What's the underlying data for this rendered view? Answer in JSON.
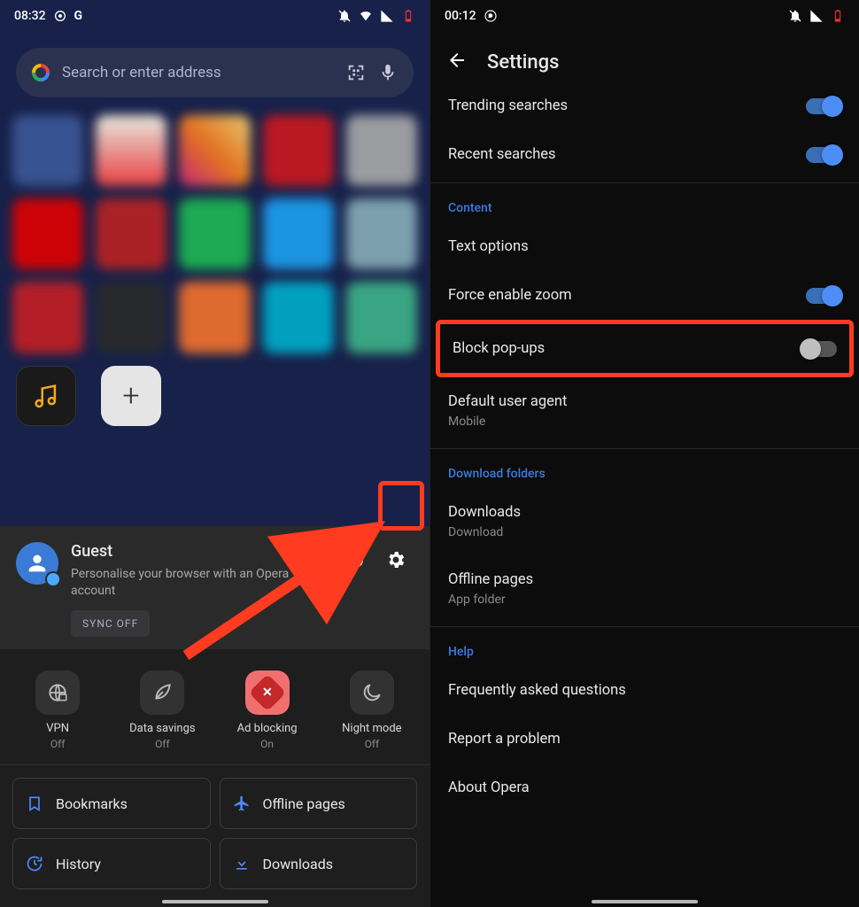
{
  "left": {
    "status_time": "08:32",
    "search_placeholder": "Search or enter address",
    "account_name": "Guest",
    "account_sub": "Personalise your browser with an Opera account",
    "sync_chip": "SYNC OFF",
    "quick": [
      {
        "label": "VPN",
        "state": "Off"
      },
      {
        "label": "Data savings",
        "state": "Off"
      },
      {
        "label": "Ad blocking",
        "state": "On"
      },
      {
        "label": "Night mode",
        "state": "Off"
      }
    ],
    "nav": {
      "bookmarks": "Bookmarks",
      "offline": "Offline pages",
      "history": "History",
      "downloads": "Downloads"
    }
  },
  "right": {
    "status_time": "00:12",
    "title": "Settings",
    "rows": {
      "trending": "Trending searches",
      "recent": "Recent searches"
    },
    "section_content": "Content",
    "content_rows": {
      "text_options": "Text options",
      "force_zoom": "Force enable zoom",
      "block_popups": "Block pop-ups",
      "default_ua": "Default user agent",
      "default_ua_sub": "Mobile"
    },
    "section_download": "Download folders",
    "download_rows": {
      "downloads": "Downloads",
      "downloads_sub": "Download",
      "offline": "Offline pages",
      "offline_sub": "App folder"
    },
    "section_help": "Help",
    "help_rows": {
      "faq": "Frequently asked questions",
      "report": "Report a problem",
      "about": "About Opera"
    }
  }
}
